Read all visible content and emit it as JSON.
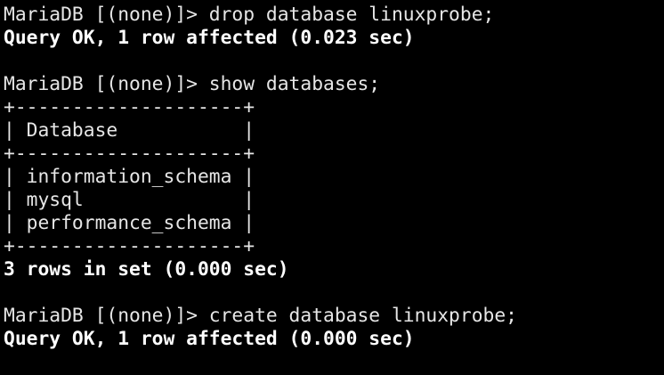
{
  "terminal": {
    "lines": [
      {
        "text": "MariaDB [(none)]> drop database linuxprobe;",
        "bold": false
      },
      {
        "text": "Query OK, 1 row affected (0.023 sec)",
        "bold": true
      },
      {
        "text": "",
        "bold": false
      },
      {
        "text": "MariaDB [(none)]> show databases;",
        "bold": false
      },
      {
        "text": "+--------------------+",
        "bold": false
      },
      {
        "text": "| Database           |",
        "bold": false
      },
      {
        "text": "+--------------------+",
        "bold": false
      },
      {
        "text": "| information_schema |",
        "bold": false
      },
      {
        "text": "| mysql              |",
        "bold": false
      },
      {
        "text": "| performance_schema |",
        "bold": false
      },
      {
        "text": "+--------------------+",
        "bold": false
      },
      {
        "text": "3 rows in set (0.000 sec)",
        "bold": true
      },
      {
        "text": "",
        "bold": false
      },
      {
        "text": "MariaDB [(none)]> create database linuxprobe;",
        "bold": false
      },
      {
        "text": "Query OK, 1 row affected (0.000 sec)",
        "bold": true
      }
    ]
  },
  "colors": {
    "background": "#000000",
    "text": "#e6e6e6",
    "bold_text": "#ffffff"
  }
}
